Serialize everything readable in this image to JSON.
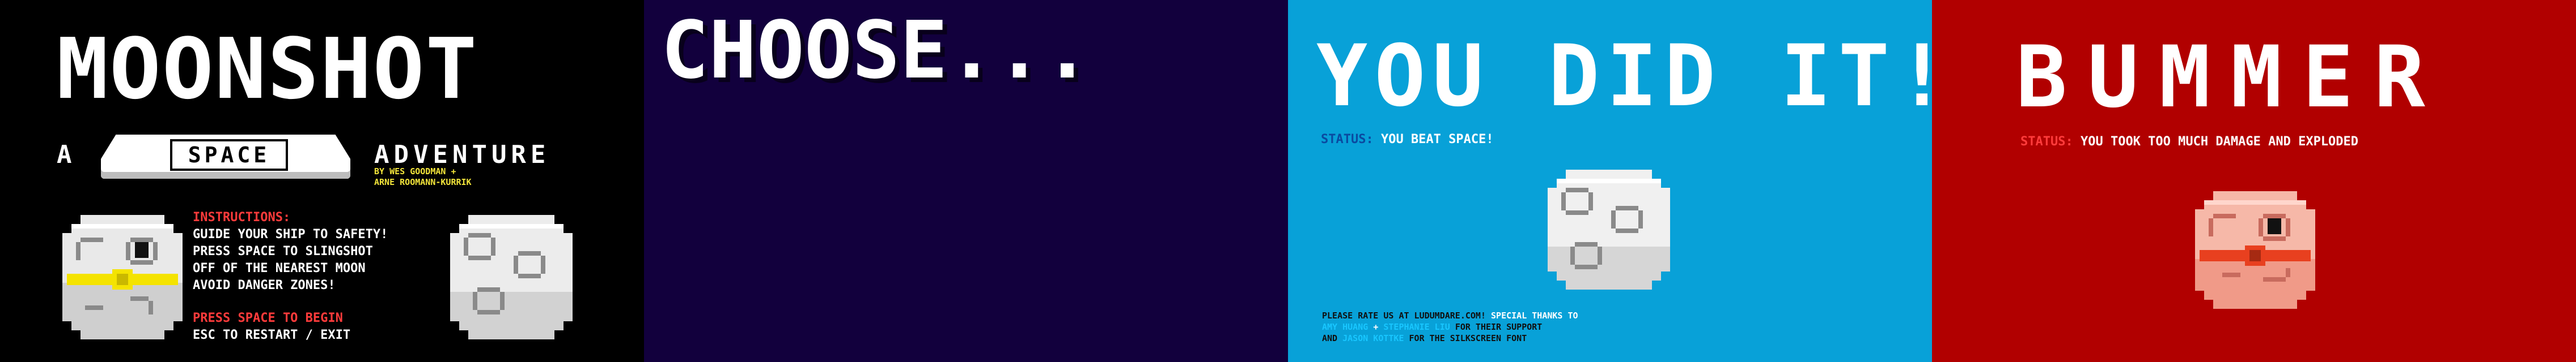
{
  "screens": {
    "title_screen": {
      "title": "MOONSHOT",
      "subtitle_a": "A",
      "subtitle_space": "SPACE",
      "subtitle_adventure": "ADVENTURE",
      "credits_line1": "BY WES GOODMAN +",
      "credits_line2": "ARNE ROOMANN-KURRIK",
      "instructions_heading": "INSTRUCTIONS:",
      "instructions": [
        "GUIDE YOUR SHIP TO SAFETY!",
        "PRESS SPACE TO SLINGSHOT",
        "OFF OF THE NEAREST MOON",
        "AVOID DANGER ZONES!"
      ],
      "press_space": "PRESS SPACE TO BEGIN",
      "esc": "ESC TO RESTART / EXIT"
    },
    "choose_screen": {
      "title": "CHOOSE..."
    },
    "win_screen": {
      "title": "YOU DID IT!",
      "status_label": "STATUS:",
      "status_value": "YOU BEAT SPACE!",
      "rate_prefix": "PLEASE RATE US AT LUDUMDARE.COM!",
      "special_thanks": "SPECIAL THANKS TO",
      "name1": "AMY HUANG",
      "plus": "+",
      "name2": "STEPHANIE LIU",
      "support": "FOR THEIR SUPPORT",
      "and": "AND",
      "name3": "JASON KOTTKE",
      "font_credit": "FOR THE SILKSCREEN FONT"
    },
    "lose_screen": {
      "title": "BUMMER",
      "status_label": "STATUS:",
      "status_value": "YOU TOOK TOO MUCH DAMAGE AND EXPLODED"
    }
  },
  "colors": {
    "title_bg": "#000000",
    "choose_bg": "#12003d",
    "win_bg": "#08a1d8",
    "lose_bg": "#b10000",
    "accent_red": "#ff3b3b",
    "accent_yellow": "#f2e43a",
    "accent_cyan": "#18c6ff"
  },
  "icons": [
    "ship-moon-icon",
    "moon-icon",
    "damaged-moon-icon"
  ]
}
